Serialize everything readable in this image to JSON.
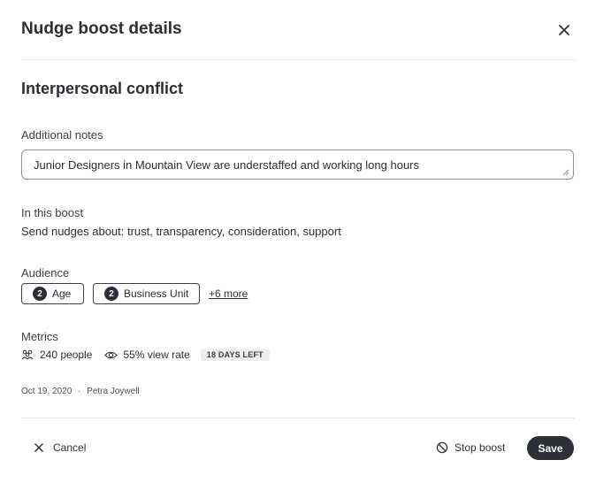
{
  "modal": {
    "title": "Nudge boost details",
    "subtitle": "Interpersonal conflict"
  },
  "notes": {
    "label": "Additional notes",
    "value": "Junior Designers in Mountain View are understaffed and working long hours"
  },
  "boost": {
    "label": "In this boost",
    "description": "Send nudges about: trust, transparency, consideration, support"
  },
  "audience": {
    "label": "Audience",
    "chips": [
      {
        "count": "2",
        "label": "Age"
      },
      {
        "count": "2",
        "label": "Business Unit"
      }
    ],
    "more_link": "+6 more"
  },
  "metrics": {
    "label": "Metrics",
    "people": "240 people",
    "view_rate": "55% view rate",
    "days_left": "18 DAYS LEFT"
  },
  "meta": {
    "date": "Oct 19, 2020",
    "separator": "·",
    "author": "Petra Joywell"
  },
  "footer": {
    "cancel_label": "Cancel",
    "stop_label": "Stop boost",
    "save_label": "Save"
  },
  "icons": {
    "close": "close-icon",
    "people": "people-icon",
    "eye": "eye-icon",
    "cancel": "close-icon",
    "stop": "prohibited-icon"
  },
  "colors": {
    "primary": "#2b2f38",
    "border": "#8e939c",
    "divider": "#e6e8ec",
    "badge_bg": "#eceef1"
  }
}
